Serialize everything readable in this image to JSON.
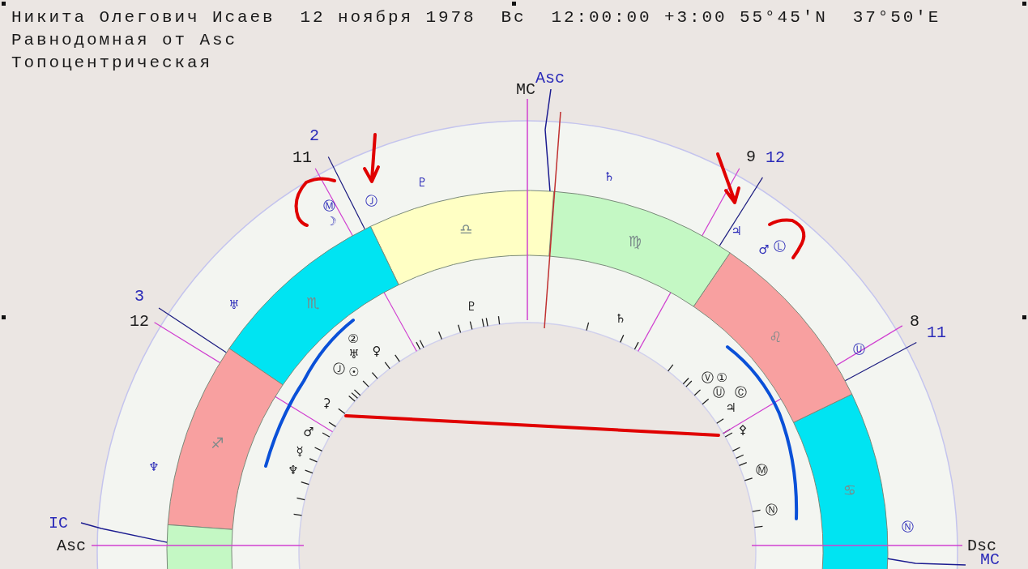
{
  "header": {
    "lines": [
      "Никита Олегович Исаев  12 ноября 1978  Вс  12:00:00 +3:00 55°45'N  37°50'E",
      "Равнодомная от Asc",
      "Топоцентрическая"
    ]
  },
  "chart": {
    "angles": [
      {
        "label": "MC",
        "kind": "inner"
      },
      {
        "label": "Asc",
        "kind": "outer"
      },
      {
        "label": "IC",
        "kind": "outer"
      },
      {
        "label": "Asc",
        "kind": "inner"
      },
      {
        "label": "Dsc",
        "kind": "inner"
      },
      {
        "label": "MC",
        "kind": "outer"
      }
    ],
    "house_cusps": [
      {
        "label": "2",
        "kind": "outer"
      },
      {
        "label": "11",
        "kind": "inner"
      },
      {
        "label": "3",
        "kind": "outer"
      },
      {
        "label": "12",
        "kind": "inner"
      },
      {
        "label": "9",
        "kind": "inner"
      },
      {
        "label": "12",
        "kind": "outer"
      },
      {
        "label": "8",
        "kind": "inner"
      },
      {
        "label": "11",
        "kind": "outer"
      }
    ],
    "signs": [
      {
        "glyph": "♋",
        "color": "#00e4f2"
      },
      {
        "glyph": "♌",
        "color": "#f8a0a0"
      },
      {
        "glyph": "♍",
        "color": "#c4f8c4"
      },
      {
        "glyph": "♎",
        "color": "#ffffc4"
      },
      {
        "glyph": "♏",
        "color": "#00e4f2"
      },
      {
        "glyph": "♐",
        "color": "#f8a0a0"
      },
      {
        "color": "#c4f8c4"
      }
    ],
    "outer_ring": [
      "♆",
      "♅",
      "☽",
      "Ⓜ",
      "Ⓙ",
      "♇",
      "♄",
      "♃",
      "♂",
      "Ⓛ",
      "Ⓤ",
      "Ⓝ"
    ],
    "inner_ring": [
      "♆",
      "☿",
      "♂",
      "⚳",
      "②",
      "♀",
      "♅",
      "Ⓙ",
      "☉",
      "♇",
      "♄",
      "Ⓥ",
      "①",
      "Ⓤ",
      "Ⓒ",
      "♃",
      "⚴",
      "Ⓜ",
      "Ⓝ"
    ]
  }
}
